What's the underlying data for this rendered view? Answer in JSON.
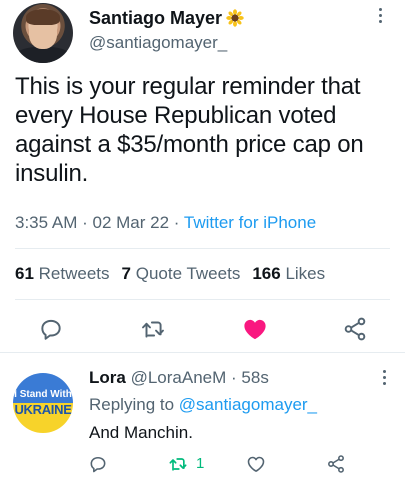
{
  "tweet": {
    "author_name": "Santiago Mayer",
    "author_emoji": "sunflower-emoji",
    "handle": "@santiagomayer_",
    "text": "This is your regular reminder that every House Republican voted against a $35/month price cap on insulin.",
    "time": "3:35 AM",
    "date": "02 Mar 22",
    "source": "Twitter for iPhone",
    "separator": "·",
    "stats": {
      "retweets_count": "61",
      "retweets_label": "Retweets",
      "quote_count": "7",
      "quote_label": "Quote Tweets",
      "likes_count": "166",
      "likes_label": "Likes"
    },
    "liked": true
  },
  "reply": {
    "author_name": "Lora",
    "handle": "@LoraAneM",
    "time": "58s",
    "replying_prefix": "Replying to",
    "replying_to": "@santiagomayer_",
    "text": "And Manchin.",
    "avatar_line1": "I Stand With",
    "avatar_line2": "UKRAINE",
    "retweet_count": "1",
    "retweeted": true
  },
  "colors": {
    "accent": "#1d9bf0",
    "like": "#f91880",
    "retweet": "#00ba7c",
    "muted": "#536471"
  }
}
